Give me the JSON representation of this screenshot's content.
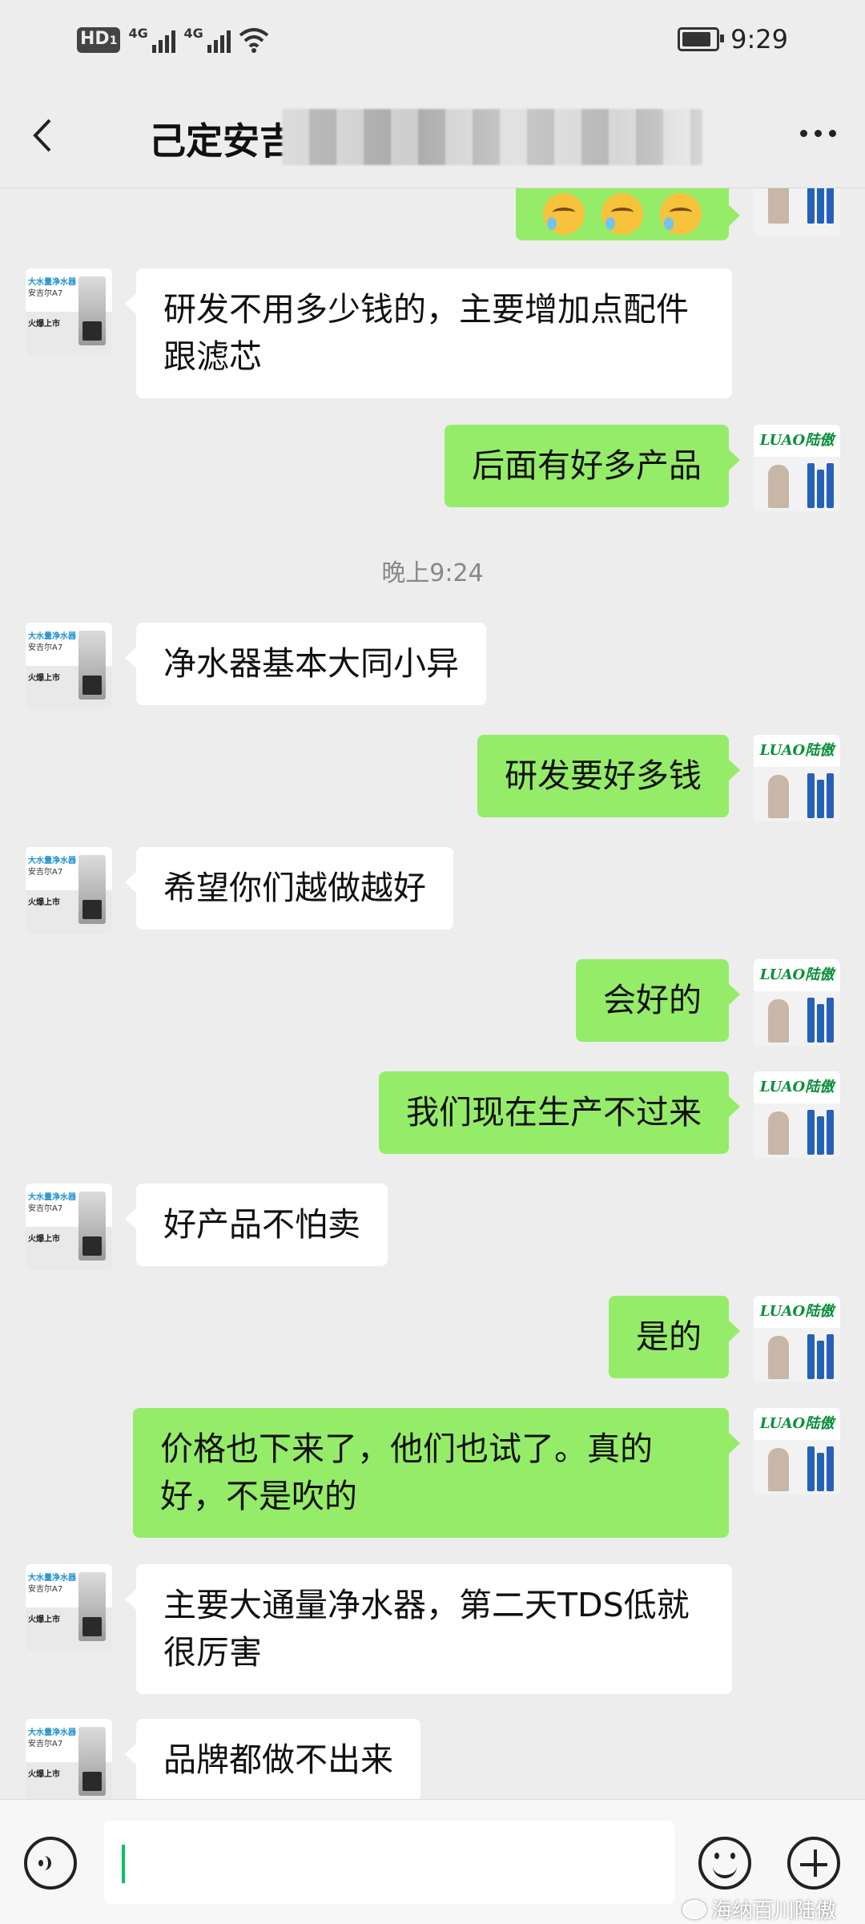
{
  "status_bar": {
    "hd": "HD",
    "sim": "1",
    "network1": "4G",
    "network2": "4G",
    "time": "9:29",
    "battery_level": 0.75
  },
  "header": {
    "title": "己定安吉",
    "back_icon": "chevron-left-icon",
    "more_icon": "more-dots-icon"
  },
  "avatars": {
    "other": {
      "line1": "大水量净水器",
      "line2": "安吉尔A7",
      "line3": "火爆上市"
    },
    "self": {
      "logo": "LUAO陆傲"
    }
  },
  "messages": [
    {
      "side": "self",
      "text": "",
      "emoji_count": 3
    },
    {
      "side": "other",
      "text": "研发不用多少钱的，主要增加点配件跟滤芯"
    },
    {
      "side": "self",
      "text": "后面有好多产品"
    },
    {
      "side": "time",
      "text": "晚上9:24"
    },
    {
      "side": "other",
      "text": "净水器基本大同小异"
    },
    {
      "side": "self",
      "text": "研发要好多钱"
    },
    {
      "side": "other",
      "text": "希望你们越做越好"
    },
    {
      "side": "self",
      "text": "会好的"
    },
    {
      "side": "self",
      "text": "我们现在生产不过来"
    },
    {
      "side": "other",
      "text": "好产品不怕卖"
    },
    {
      "side": "self",
      "text": "是的"
    },
    {
      "side": "self",
      "text": "价格也下来了，他们也试了。真的好，不是吹的"
    },
    {
      "side": "other",
      "text": "主要大通量净水器，第二天TDS低就很厉害"
    },
    {
      "side": "other",
      "text": "品牌都做不出来"
    }
  ],
  "input_bar": {
    "voice_icon": "voice-icon",
    "emoji_icon": "emoji-icon",
    "plus_icon": "plus-icon",
    "text": ""
  },
  "watermark": "海纳百川陆傲"
}
